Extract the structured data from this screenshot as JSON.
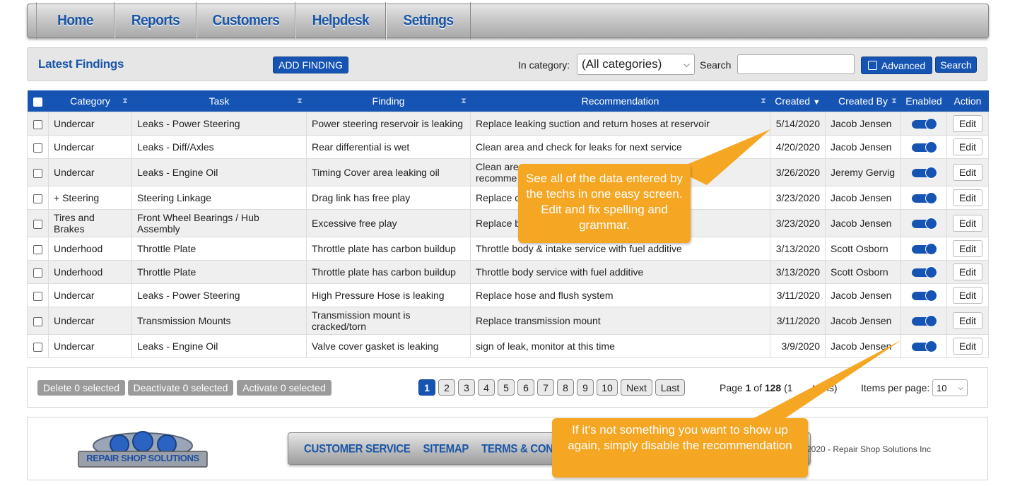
{
  "nav": {
    "items": [
      {
        "label": "Home",
        "name": "nav-home"
      },
      {
        "label": "Reports",
        "name": "nav-reports"
      },
      {
        "label": "Customers",
        "name": "nav-customers"
      },
      {
        "label": "Helpdesk",
        "name": "nav-helpdesk"
      },
      {
        "label": "Settings",
        "name": "nav-settings"
      }
    ]
  },
  "toolbar": {
    "title": "Latest Findings",
    "add_label": "ADD FINDING",
    "category_label": "In category:",
    "category_value": "(All categories)",
    "search_label": "Search",
    "search_value": "",
    "advanced_label": "Advanced",
    "search_button": "Search"
  },
  "table": {
    "columns": {
      "category": "Category",
      "task": "Task",
      "finding": "Finding",
      "recommendation": "Recommendation",
      "created": "Created",
      "created_by": "Created By",
      "enabled": "Enabled",
      "action": "Action"
    },
    "edit_label": "Edit",
    "rows": [
      {
        "category": "Undercar",
        "task": "Leaks - Power Steering",
        "finding": "Power steering reservoir is leaking",
        "recommendation": "Replace leaking suction and return hoses at reservoir",
        "created": "5/14/2020",
        "created_by": "Jacob Jensen",
        "enabled": true
      },
      {
        "category": "Undercar",
        "task": "Leaks - Diff/Axles",
        "finding": "Rear differential is wet",
        "recommendation": "Clean area and check for leaks for next service",
        "created": "4/20/2020",
        "created_by": "Jacob Jensen",
        "enabled": true
      },
      {
        "category": "Undercar",
        "task": "Leaks - Engine Oil",
        "finding": "Timing Cover area leaking oil",
        "recommendation": "Clean are\nrecomme",
        "created": "3/26/2020",
        "created_by": "Jeremy Gervig",
        "enabled": true
      },
      {
        "category": "+ Steering",
        "task": "Steering Linkage",
        "finding": "Drag link has free play",
        "recommendation": "Replace c",
        "created": "3/23/2020",
        "created_by": "Jacob Jensen",
        "enabled": true
      },
      {
        "category": "Tires and Brakes",
        "task": "Front Wheel Bearings / Hub Assembly",
        "finding": "Excessive free play",
        "recommendation": "Replace b",
        "created": "3/23/2020",
        "created_by": "Jacob Jensen",
        "enabled": true
      },
      {
        "category": "Underhood",
        "task": "Throttle Plate",
        "finding": "Throttle plate has carbon buildup",
        "recommendation": "Throttle body & intake service with fuel additive",
        "created": "3/13/2020",
        "created_by": "Scott Osborn",
        "enabled": true
      },
      {
        "category": "Underhood",
        "task": "Throttle Plate",
        "finding": "Throttle plate has carbon buildup",
        "recommendation": "Throttle body service with fuel additive",
        "created": "3/13/2020",
        "created_by": "Scott Osborn",
        "enabled": true
      },
      {
        "category": "Undercar",
        "task": "Leaks - Power Steering",
        "finding": "High Pressure Hose is leaking",
        "recommendation": "Replace hose and flush system",
        "created": "3/11/2020",
        "created_by": "Jacob Jensen",
        "enabled": true
      },
      {
        "category": "Undercar",
        "task": "Transmission Mounts",
        "finding": "Transmission mount is cracked/torn",
        "recommendation": "Replace transmission mount",
        "created": "3/11/2020",
        "created_by": "Jacob Jensen",
        "enabled": true
      },
      {
        "category": "Undercar",
        "task": "Leaks - Engine Oil",
        "finding": "Valve cover gasket is leaking",
        "recommendation": "sign of leak, monitor at this time",
        "created": "3/9/2020",
        "created_by": "Jacob Jensen",
        "enabled": true
      }
    ]
  },
  "actions": {
    "delete_label": "Delete 0 selected",
    "deactivate_label": "Deactivate 0 selected",
    "activate_label": "Activate 0 selected"
  },
  "pager": {
    "pages": [
      "1",
      "2",
      "3",
      "4",
      "5",
      "6",
      "7",
      "8",
      "9",
      "10"
    ],
    "current": "1",
    "next_label": "Next",
    "last_label": "Last",
    "info_prefix": "Page ",
    "info_current": "1",
    "info_of": " of ",
    "info_total": "128",
    "info_suffix": " (1",
    "info_items": "tems)",
    "ipp_label": "Items per page:",
    "ipp_value": "10"
  },
  "footer": {
    "logo_text": "REPAIR SHOP SOLUTIONS",
    "links": [
      "CUSTOMER SERVICE",
      "SITEMAP",
      "TERMS & CONDIT"
    ],
    "copyright": "2020 - Repair Shop Solutions Inc"
  },
  "callouts": {
    "first": "See all of the data entered by the techs in one easy screen. Edit and fix spelling and grammar.",
    "second": "If it's not something you want to show up again, simply disable the recommendation"
  },
  "colors": {
    "accent": "#1654b4",
    "nav_text": "#1a56a7",
    "callout": "#f5a623"
  }
}
